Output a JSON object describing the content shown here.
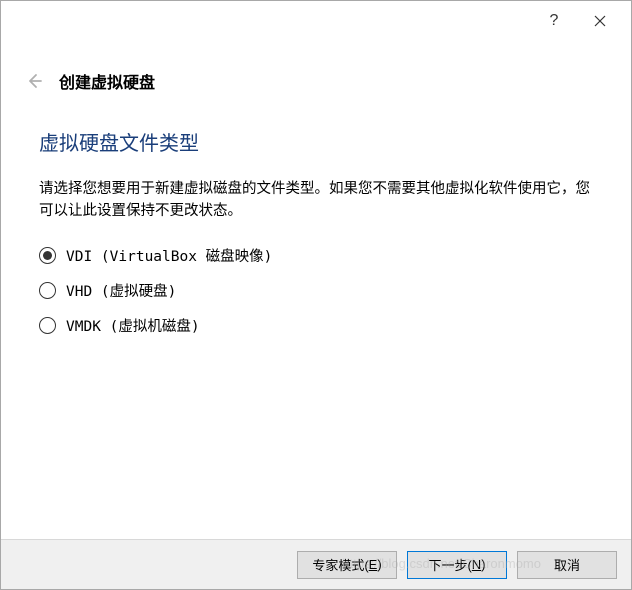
{
  "titlebar": {
    "help_symbol": "?",
    "close_label": "关闭"
  },
  "header": {
    "title": "创建虚拟硬盘"
  },
  "content": {
    "section_title": "虚拟硬盘文件类型",
    "description": "请选择您想要用于新建虚拟磁盘的文件类型。如果您不需要其他虚拟化软件使用它，您可以让此设置保持不更改状态。",
    "options": [
      {
        "label": "VDI (VirtualBox 磁盘映像)",
        "selected": true
      },
      {
        "label": "VHD (虚拟硬盘)",
        "selected": false
      },
      {
        "label": "VMDK (虚拟机磁盘)",
        "selected": false
      }
    ]
  },
  "footer": {
    "expert_mode": {
      "prefix": "专家模式(",
      "key": "E",
      "suffix": ")"
    },
    "next": {
      "prefix": "下一步(",
      "key": "N",
      "suffix": ")"
    },
    "cancel": "取消"
  },
  "watermark": "https://blog.csdn.net/Charonmomo"
}
